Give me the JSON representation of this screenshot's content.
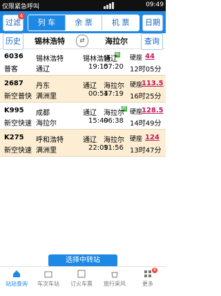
{
  "status": {
    "left": "仅限紧急呼叫",
    "right": "09:49",
    "battery": "48"
  },
  "header": {
    "filter": "过滤",
    "filter_badge": "4",
    "tabs": [
      "列 车",
      "余 票",
      "机 票"
    ],
    "date": "日期"
  },
  "stations": {
    "history": "历史",
    "from": "锡林浩特",
    "to": "海拉尔",
    "query": "查询"
  },
  "trains": [
    {
      "no": "6036",
      "type": "普客",
      "dep": "锡林浩特",
      "from": "通辽",
      "arr": "锡林浩特",
      "to": "通辽",
      "dep_time": "19:15",
      "arr_time": "07:20",
      "seat": "硬座",
      "seat_count": "44",
      "duration": "12时05分",
      "has_mark": true
    },
    {
      "no": "2687",
      "type": "新空普快",
      "dep": "丹东",
      "from": "满洲里",
      "arr": "通辽",
      "to": "海拉尔",
      "dep_time": "00:54",
      "arr_time": "17:19",
      "seat": "硬座",
      "seat_count": "113.5",
      "duration": "16时25分"
    },
    {
      "no": "K995",
      "type": "新空快速",
      "dep": "成都",
      "from": "海拉尔",
      "arr": "通辽",
      "to": "海拉尔",
      "dep_time": "15:49",
      "arr_time": "06:38",
      "seat": "硬座",
      "seat_count": "128.5",
      "duration": "14时49分",
      "has_mark": true
    },
    {
      "no": "K275",
      "type": "新空快速",
      "dep": "呼和浩特",
      "from": "满洲里",
      "arr": "通辽",
      "to": "海拉尔",
      "dep_time": "22:09",
      "arr_time": "11:56",
      "seat": "硬座",
      "seat_count": "124",
      "duration": "13时47分"
    }
  ],
  "transfer": "选择中转站",
  "nav": [
    "站站查询",
    "车次车站",
    "订火车票",
    "旅行采风",
    "更多"
  ],
  "nav_badge": "8",
  "colors": {
    "primary": "#1e88e5",
    "rowAlt": "#fdeed3",
    "price": "#c2185b"
  }
}
